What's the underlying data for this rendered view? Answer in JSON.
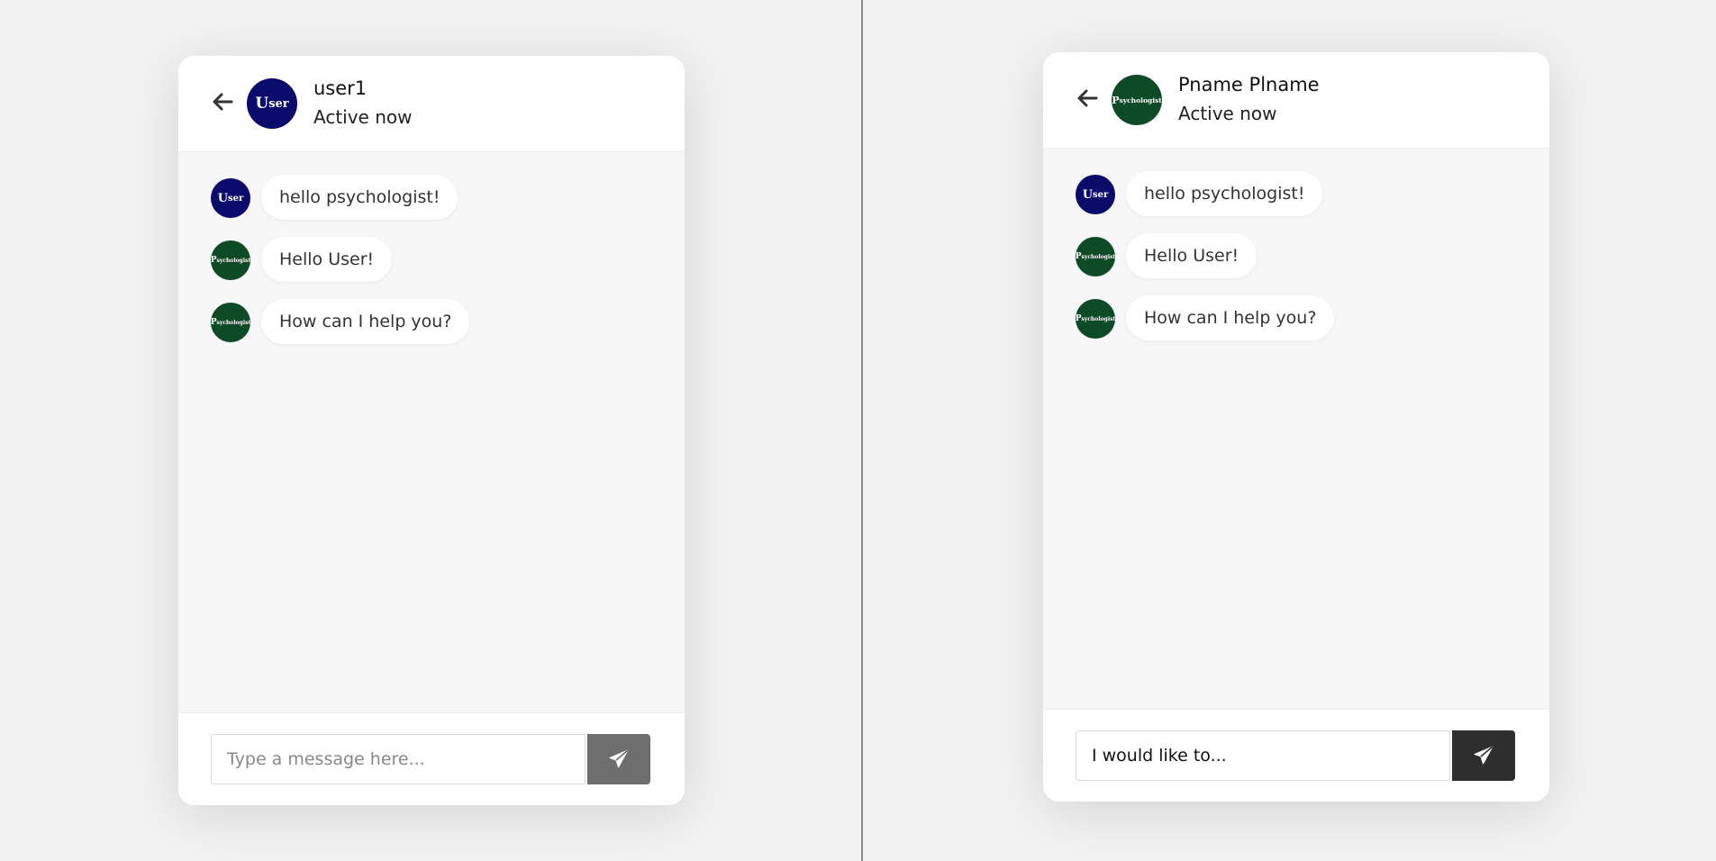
{
  "colors": {
    "user_avatar": "#0b0b6b",
    "psychologist_avatar": "#0d4a26",
    "send_disabled": "#6e6e6e",
    "send_active": "#2e2e2e",
    "bubble": "#ffffff"
  },
  "left_chat": {
    "header": {
      "back_icon": "arrow-left-icon",
      "avatar_initial": "U",
      "avatar_rest": "ser",
      "name": "user1",
      "status": "Active now"
    },
    "messages": [
      {
        "sender": "user",
        "avatar_initial": "U",
        "avatar_rest": "ser",
        "text": "hello psychologist!"
      },
      {
        "sender": "psychologist",
        "avatar_initial": "P",
        "avatar_rest": "sychologist",
        "text": "Hello User!"
      },
      {
        "sender": "psychologist",
        "avatar_initial": "P",
        "avatar_rest": "sychologist",
        "text": "How can I help you?"
      }
    ],
    "input": {
      "placeholder": "Type a message here...",
      "value": ""
    },
    "send_icon": "paper-plane-icon"
  },
  "right_chat": {
    "header": {
      "back_icon": "arrow-left-icon",
      "avatar_initial": "P",
      "avatar_rest": "sychologist",
      "name": "Pname Plname",
      "status": "Active now"
    },
    "messages": [
      {
        "sender": "user",
        "avatar_initial": "U",
        "avatar_rest": "ser",
        "text": "hello psychologist!"
      },
      {
        "sender": "psychologist",
        "avatar_initial": "P",
        "avatar_rest": "sychologist",
        "text": "Hello User!"
      },
      {
        "sender": "psychologist",
        "avatar_initial": "P",
        "avatar_rest": "sychologist",
        "text": "How can I help you?"
      }
    ],
    "input": {
      "placeholder": "Type a message here...",
      "value": "I would like to..."
    },
    "send_icon": "paper-plane-icon"
  }
}
